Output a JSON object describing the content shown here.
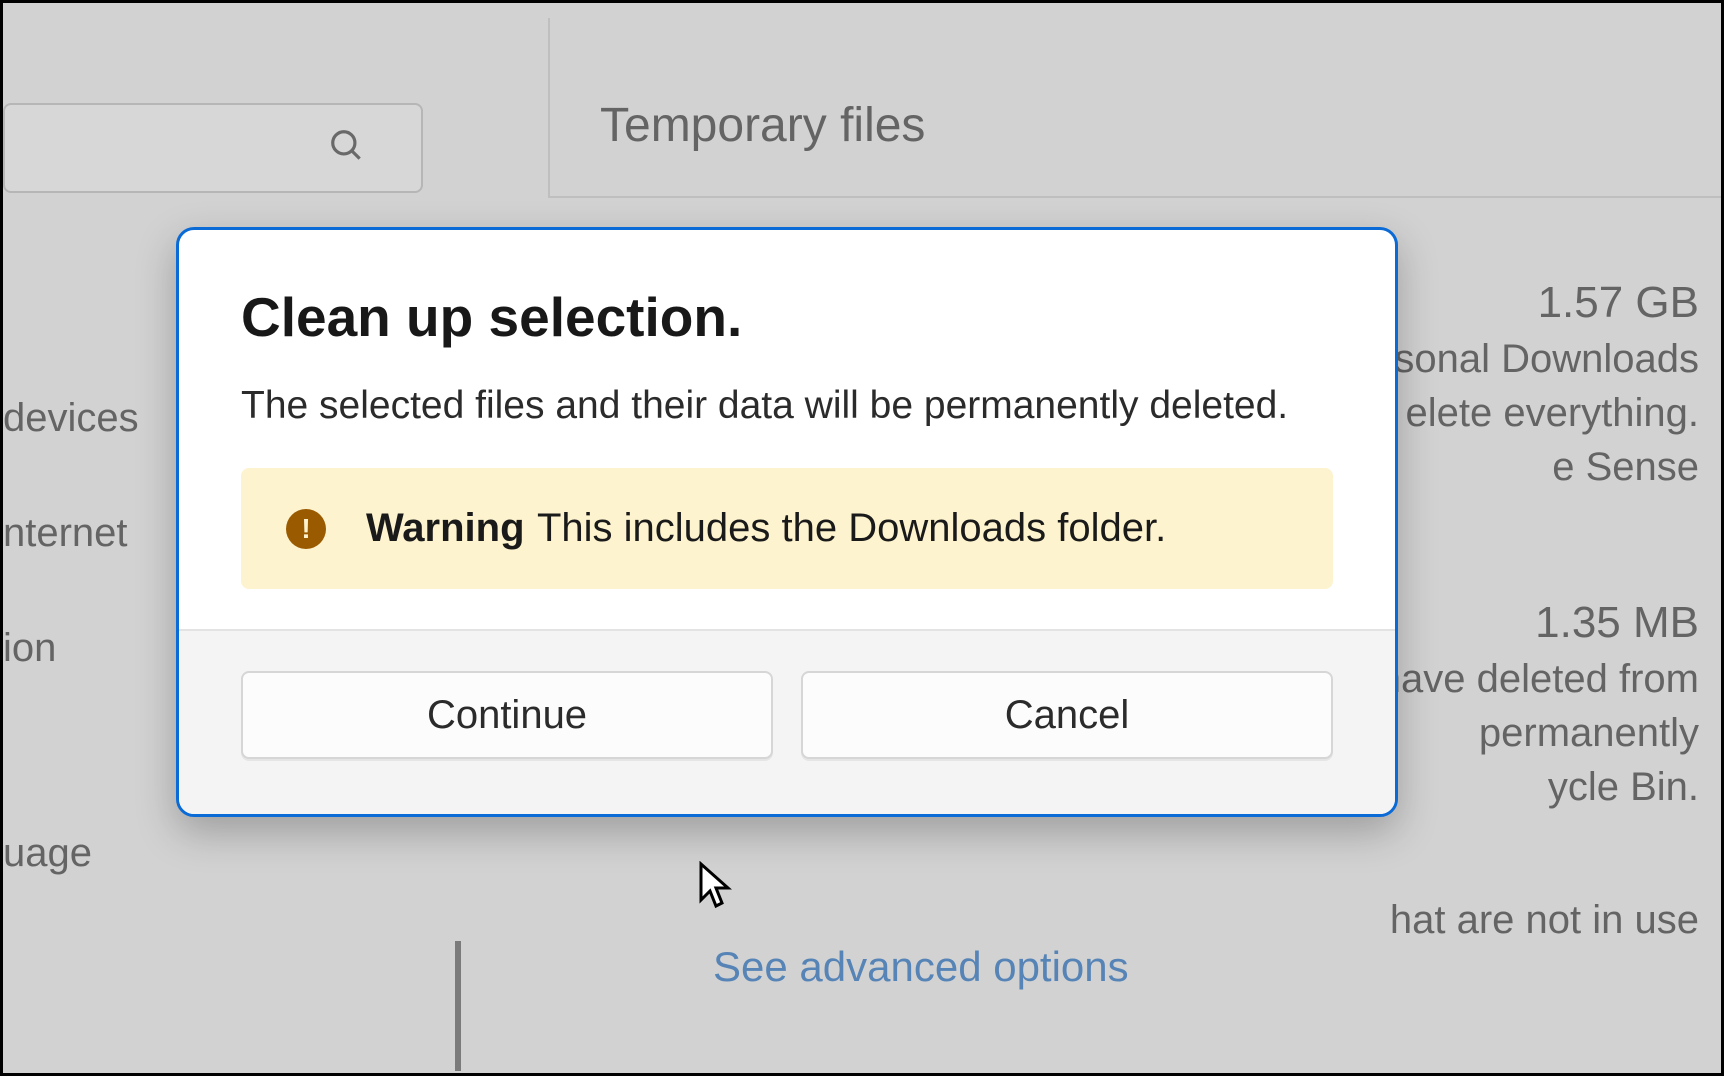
{
  "page": {
    "title": "Temporary files"
  },
  "sidebar": {
    "items": [
      "devices",
      "nternet",
      "ion",
      "uage"
    ]
  },
  "background": {
    "item1_size": "1.57 GB",
    "item1_line1": "ersonal Downloads",
    "item1_line2": "elete everything.",
    "item1_line3": "e Sense",
    "item2_size": "1.35 MB",
    "item2_line1": "have deleted from",
    "item2_line2": "permanently",
    "item2_line3": "ycle Bin.",
    "item3_line1": "hat are not in use",
    "advanced_link": "See advanced options"
  },
  "dialog": {
    "title": "Clean up selection.",
    "body": "The selected files and their data will be permanently deleted.",
    "warning_label": "Warning",
    "warning_message": "This includes the Downloads folder.",
    "continue_label": "Continue",
    "cancel_label": "Cancel"
  }
}
